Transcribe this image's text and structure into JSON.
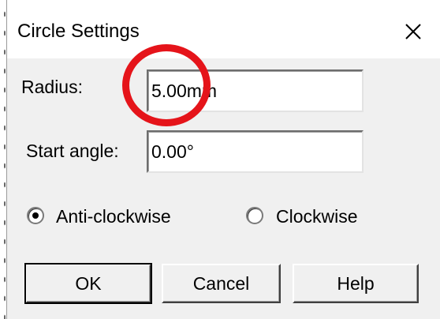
{
  "dialog": {
    "title": "Circle Settings",
    "close_icon": "close-icon"
  },
  "radius": {
    "label": "Radius:",
    "value": "5.00mm"
  },
  "start_angle": {
    "label": "Start angle:",
    "value": "0.00°"
  },
  "direction": {
    "options": [
      {
        "label": "Anti-clockwise",
        "checked": true
      },
      {
        "label": "Clockwise",
        "checked": false
      }
    ]
  },
  "buttons": {
    "ok": "OK",
    "cancel": "Cancel",
    "help": "Help"
  },
  "annotation": {
    "color": "#e5141a"
  }
}
